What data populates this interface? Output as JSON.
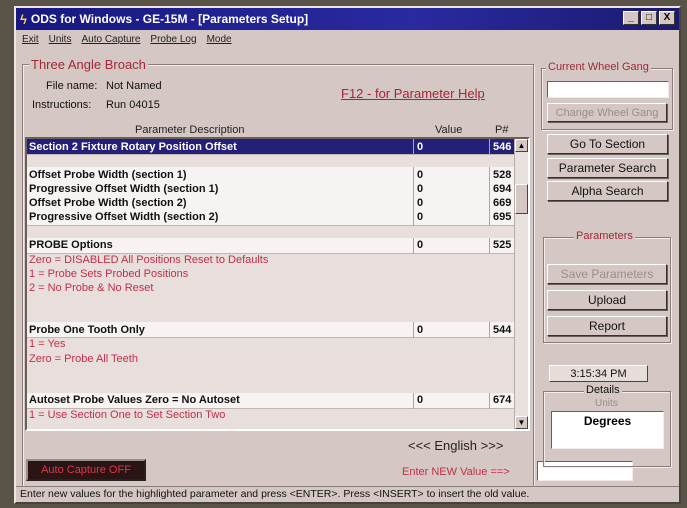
{
  "window": {
    "title": "ODS for Windows - GE-15M - [Parameters Setup]",
    "buttons": {
      "minimize": "_",
      "maximize": "□",
      "close": "X"
    }
  },
  "menu": [
    "Exit",
    "Units",
    "Auto Capture",
    "Probe Log",
    "Mode"
  ],
  "broach": {
    "group_title": "Three Angle Broach",
    "file_label": "File name:",
    "file_value": "Not Named",
    "instructions_label": "Instructions:",
    "instructions_value": "Run 04015",
    "help_text": "F12 - for Parameter Help"
  },
  "grid": {
    "headers": {
      "description": "Parameter Description",
      "value": "Value",
      "pnum": "P#"
    },
    "rows": [
      {
        "type": "selected",
        "desc": "Section 2 Fixture Rotary Position Offset",
        "value": "0",
        "pnum": "546"
      },
      {
        "type": "blank"
      },
      {
        "type": "param",
        "desc": "Offset Probe Width (section 1)",
        "value": "0",
        "pnum": "528"
      },
      {
        "type": "param",
        "desc": "Progressive Offset Width (section 1)",
        "value": "0",
        "pnum": "694"
      },
      {
        "type": "param",
        "desc": "Offset Probe Width (section 2)",
        "value": "0",
        "pnum": "669"
      },
      {
        "type": "param",
        "desc": "Progressive Offset Width (section 2)",
        "value": "0",
        "pnum": "695"
      },
      {
        "type": "blank"
      },
      {
        "type": "param",
        "desc": "PROBE Options",
        "value": "0",
        "pnum": "525"
      },
      {
        "type": "note",
        "desc": "Zero = DISABLED All Positions Reset to Defaults"
      },
      {
        "type": "note",
        "desc": "    1 = Probe Sets Probed Positions"
      },
      {
        "type": "note",
        "desc": "    2 = No Probe & No Reset"
      },
      {
        "type": "blank"
      },
      {
        "type": "blank"
      },
      {
        "type": "param",
        "desc": "Probe One Tooth Only",
        "value": "0",
        "pnum": "544"
      },
      {
        "type": "note",
        "desc": "        1 = Yes"
      },
      {
        "type": "note",
        "desc": "  Zero = Probe All Teeth"
      },
      {
        "type": "blank"
      },
      {
        "type": "blank"
      },
      {
        "type": "param",
        "desc": "Autoset Probe Values  Zero = No Autoset",
        "value": "0",
        "pnum": "674"
      },
      {
        "type": "note",
        "desc": "  1 = Use Section One to Set Section Two"
      }
    ]
  },
  "wheel_gang": {
    "group_title": "Current Wheel Gang",
    "value": "",
    "change_button": "Change Wheel Gang"
  },
  "nav_buttons": {
    "goto_section": "Go To Section",
    "parameter_search": "Parameter Search",
    "alpha_search": "Alpha Search"
  },
  "parameters_group": {
    "title": "Parameters",
    "save": "Save Parameters",
    "upload": "Upload",
    "report": "Report"
  },
  "clock": "3:15:34 PM",
  "details": {
    "title": "Details",
    "units_label": "Units",
    "units_value": "Degrees"
  },
  "language": "<<< English >>>",
  "auto_capture": "Auto Capture OFF",
  "enter_new_label": "Enter NEW Value ==>",
  "enter_new_value": "",
  "status_bar": "Enter new values for the highlighted parameter and press <ENTER>.  Press <INSERT> to insert the old value.",
  "colors": {
    "titlebar": "#24207a",
    "selection": "#24207a",
    "accent_red": "#c0304a",
    "panel": "#d5c8c4"
  }
}
